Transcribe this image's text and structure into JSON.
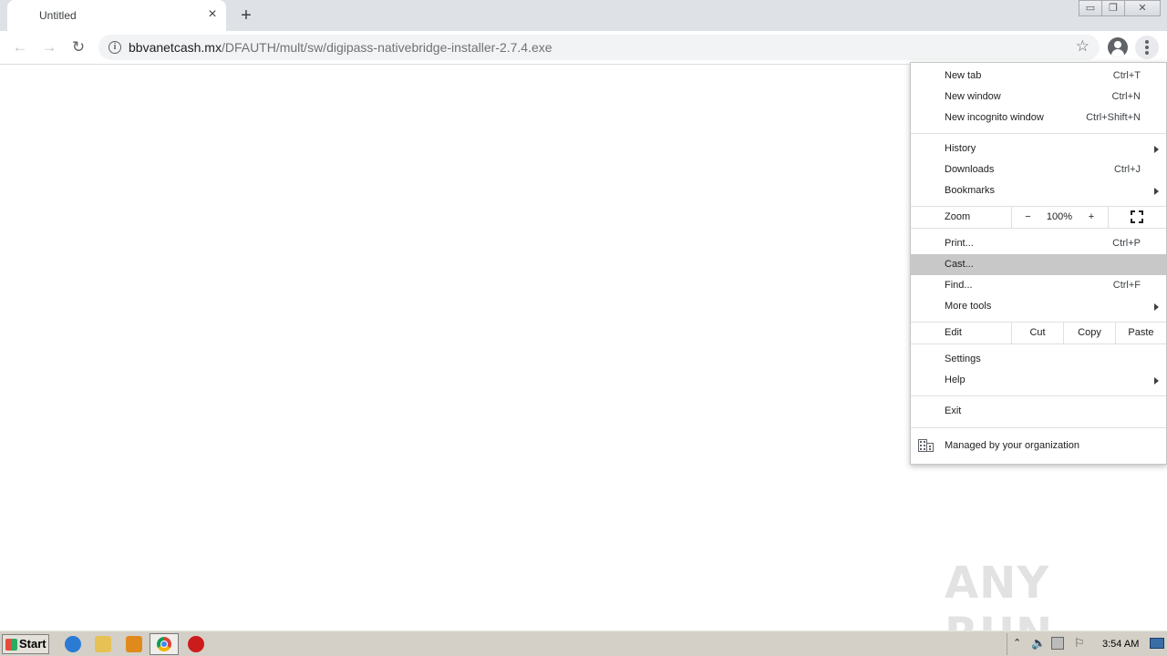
{
  "tab": {
    "title": "Untitled",
    "close_icon": "×",
    "new_tab_icon": "+"
  },
  "window_controls": {
    "minimize": "▭",
    "restore": "❐",
    "close": "✕"
  },
  "toolbar": {
    "back_icon": "←",
    "forward_icon": "→",
    "reload_icon": "↻",
    "url_host": "bbvanetcash.mx",
    "url_path": "/DFAUTH/mult/sw/digipass-nativebridge-installer-2.7.4.exe",
    "info_icon": "i",
    "star_icon": "☆"
  },
  "menu": {
    "new_tab": {
      "label": "New tab",
      "shortcut": "Ctrl+T"
    },
    "new_window": {
      "label": "New window",
      "shortcut": "Ctrl+N"
    },
    "incognito": {
      "label": "New incognito window",
      "shortcut": "Ctrl+Shift+N"
    },
    "history": {
      "label": "History"
    },
    "downloads": {
      "label": "Downloads",
      "shortcut": "Ctrl+J"
    },
    "bookmarks": {
      "label": "Bookmarks"
    },
    "zoom": {
      "label": "Zoom",
      "minus": "−",
      "value": "100%",
      "plus": "+"
    },
    "print": {
      "label": "Print...",
      "shortcut": "Ctrl+P"
    },
    "cast": {
      "label": "Cast..."
    },
    "find": {
      "label": "Find...",
      "shortcut": "Ctrl+F"
    },
    "more_tools": {
      "label": "More tools"
    },
    "edit": {
      "label": "Edit",
      "cut": "Cut",
      "copy": "Copy",
      "paste": "Paste"
    },
    "settings": {
      "label": "Settings"
    },
    "help": {
      "label": "Help"
    },
    "exit": {
      "label": "Exit"
    },
    "managed": {
      "label": "Managed by your organization"
    }
  },
  "watermark": "ANY RUN",
  "taskbar": {
    "start_label": "Start",
    "clock": "3:54 AM"
  },
  "colors": {
    "tabstrip": "#dee1e6",
    "menu_highlight": "#c8c8c8",
    "taskbar": "#d4d0c8"
  }
}
